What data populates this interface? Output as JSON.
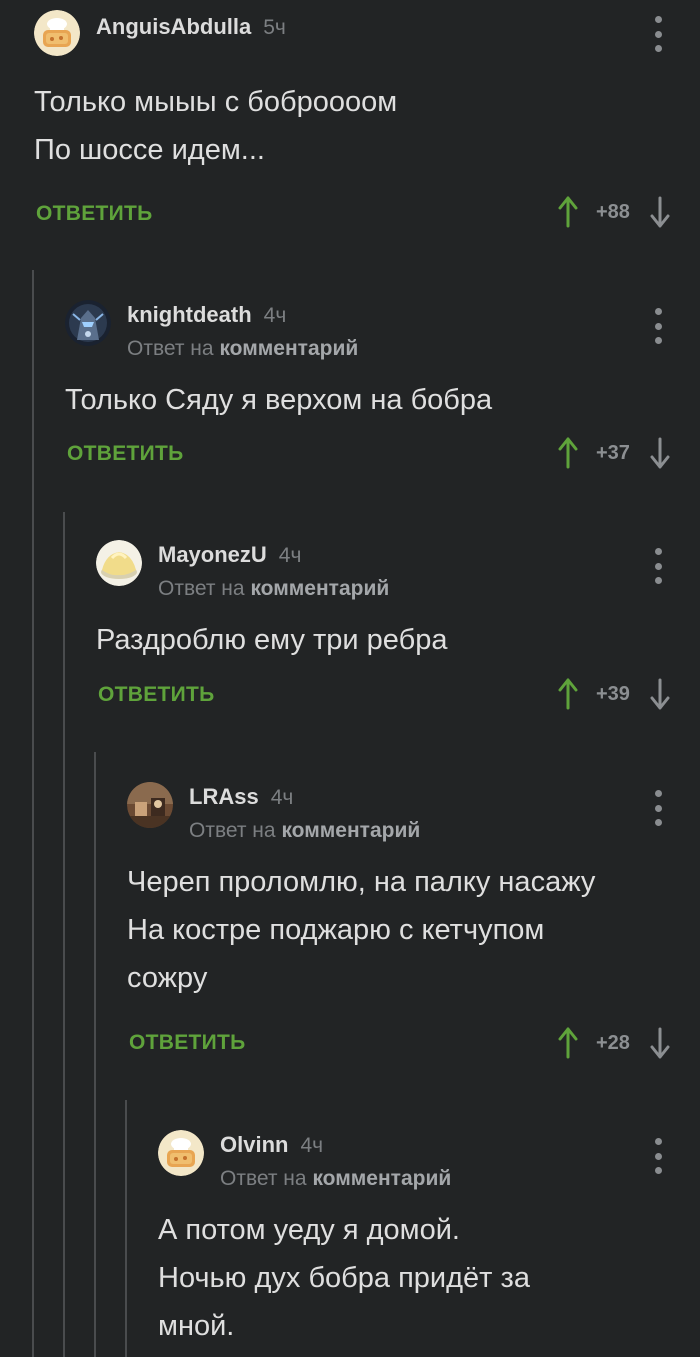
{
  "colors": {
    "background": "#222425",
    "accent_green": "#5fa33b",
    "text": "#dfdfdf",
    "muted": "#7c7f82"
  },
  "comments": [
    {
      "author": "AnguisAbdulla",
      "time": "5ч",
      "avatar_icon": "chef-bread-avatar",
      "reply_prefix": "",
      "reply_target": "",
      "text": "Только мыыы с боброооом\nПо шоссе идем...",
      "reply_label": "ОТВЕТИТЬ",
      "score": "+88"
    },
    {
      "author": "knightdeath",
      "time": "4ч",
      "avatar_icon": "knight-avatar",
      "reply_prefix": "Ответ на",
      "reply_target": "комментарий",
      "text": "Только Сяду я верхом на бобра",
      "reply_label": "ОТВЕТИТЬ",
      "score": "+37"
    },
    {
      "author": "MayonezU",
      "time": "4ч",
      "avatar_icon": "mayonnaise-avatar",
      "reply_prefix": "Ответ на",
      "reply_target": "комментарий",
      "text": "Раздроблю ему три ребра",
      "reply_label": "ОТВЕТИТЬ",
      "score": "+39"
    },
    {
      "author": "LRAss",
      "time": "4ч",
      "avatar_icon": "photo-avatar",
      "reply_prefix": "Ответ на",
      "reply_target": "комментарий",
      "text": "Череп проломлю, на палку насажу\nНа костре поджарю с кетчупом\nсожру",
      "reply_label": "ОТВЕТИТЬ",
      "score": "+28"
    },
    {
      "author": "Olvinn",
      "time": "4ч",
      "avatar_icon": "chef-bread-avatar",
      "reply_prefix": "Ответ на",
      "reply_target": "комментарий",
      "text": "А потом уеду я домой.\nНочью дух бобра придёт за\nмной.",
      "reply_label": "",
      "score": ""
    }
  ]
}
